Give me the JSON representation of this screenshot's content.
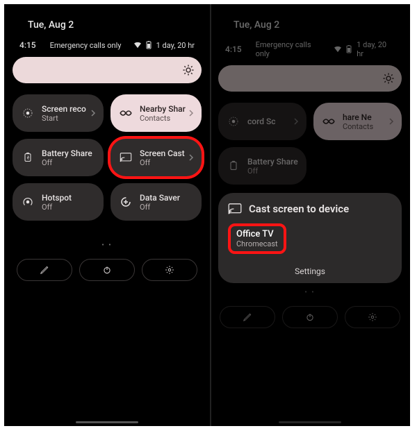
{
  "left": {
    "date": "Tue, Aug 2",
    "time": "4:15",
    "status_text": "Emergency calls only",
    "battery": "1 day, 20 hr",
    "tiles": [
      {
        "label": "Screen reco",
        "sub": "Start",
        "icon": "record-icon"
      },
      {
        "label": "Nearby Shar",
        "sub": "Contacts",
        "icon": "nearby-share-icon"
      },
      {
        "label": "Battery Share",
        "sub": "Off",
        "icon": "battery-share-icon"
      },
      {
        "label": "Screen Cast",
        "sub": "Off",
        "icon": "cast-icon"
      },
      {
        "label": "Hotspot",
        "sub": "Off",
        "icon": "hotspot-icon"
      },
      {
        "label": "Data Saver",
        "sub": "Off",
        "icon": "data-saver-icon"
      }
    ],
    "highlight_tile_index": 3
  },
  "right": {
    "date": "Tue, Aug 2",
    "time": "4:15",
    "status_text": "Emergency calls only",
    "battery": "1 day, 20 hr",
    "tiles": [
      {
        "label": "cord    Sc",
        "sub": "",
        "icon": "record-icon"
      },
      {
        "label": "hare    Ne",
        "sub": "Contacts",
        "icon": "nearby-share-icon"
      },
      {
        "label": "Battery Share",
        "sub": "Off",
        "icon": "battery-share-icon"
      }
    ],
    "cast": {
      "title": "Cast screen to device",
      "devices": [
        {
          "name": "Office TV",
          "type": "Chromecast"
        }
      ],
      "settings_label": "Settings"
    }
  },
  "colors": {
    "highlight": "#ff1414",
    "tile_bg": "#2f2c2c",
    "tile_active_bg": "#eedadd",
    "brightness_track": "#ecd9da"
  }
}
